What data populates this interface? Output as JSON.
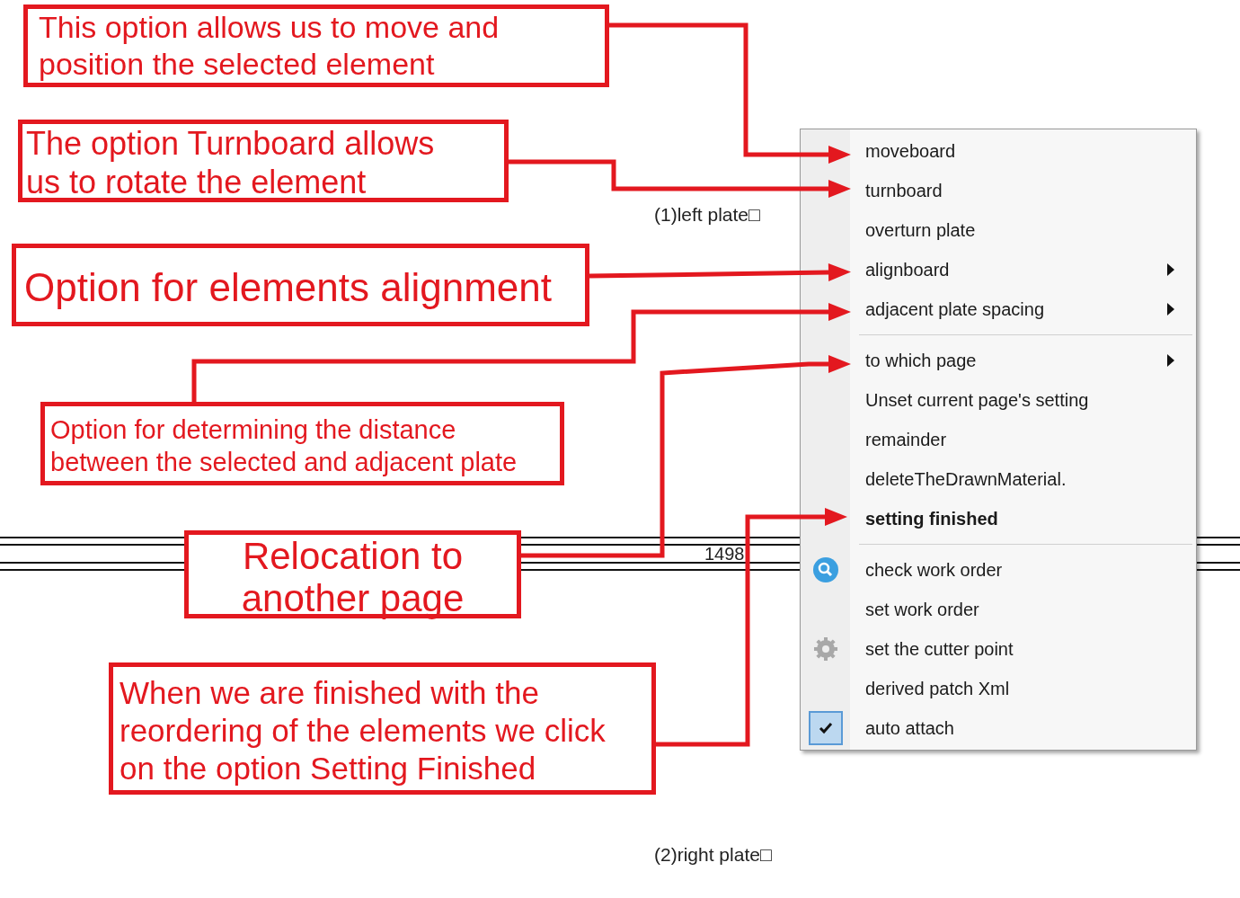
{
  "canvas": {
    "labels": [
      {
        "text": "(1)left plate□"
      },
      {
        "text": "1498"
      },
      {
        "text": "(2)right plate□"
      }
    ]
  },
  "context_menu": {
    "items": [
      {
        "kind": "item",
        "label": "moveboard",
        "submenu": false,
        "default": false,
        "checked": false
      },
      {
        "kind": "item",
        "label": "turnboard",
        "submenu": false,
        "default": false,
        "checked": false
      },
      {
        "kind": "item",
        "label": "overturn plate",
        "submenu": false,
        "default": false,
        "checked": false
      },
      {
        "kind": "item",
        "label": "alignboard",
        "submenu": true,
        "default": false,
        "checked": false
      },
      {
        "kind": "item",
        "label": "adjacent plate spacing",
        "submenu": true,
        "default": false,
        "checked": false
      },
      {
        "kind": "separator"
      },
      {
        "kind": "item",
        "label": "to which page",
        "submenu": true,
        "default": false,
        "checked": false
      },
      {
        "kind": "item",
        "label": "Unset current page's setting",
        "submenu": false,
        "default": false,
        "checked": false
      },
      {
        "kind": "item",
        "label": "remainder",
        "submenu": false,
        "default": false,
        "checked": false
      },
      {
        "kind": "item",
        "label": "deleteTheDrawnMaterial.",
        "submenu": false,
        "default": false,
        "checked": false
      },
      {
        "kind": "item",
        "label": "setting finished",
        "submenu": false,
        "default": true,
        "checked": false
      },
      {
        "kind": "separator"
      },
      {
        "kind": "item",
        "label": "check work order",
        "submenu": false,
        "default": false,
        "checked": false
      },
      {
        "kind": "item",
        "label": "set work order",
        "submenu": false,
        "default": false,
        "checked": false
      },
      {
        "kind": "item",
        "label": "set the cutter point",
        "submenu": false,
        "default": false,
        "checked": false
      },
      {
        "kind": "item",
        "label": "derived patch Xml",
        "submenu": false,
        "default": false,
        "checked": false
      },
      {
        "kind": "item",
        "label": "auto attach",
        "submenu": false,
        "default": false,
        "checked": true
      }
    ]
  },
  "callouts": [
    {
      "text": "This option allows us to move and position the selected element"
    },
    {
      "text": "The option Turnboard allows us to rotate the element"
    },
    {
      "text": "Option for elements alignment"
    },
    {
      "text": "Option for determining the distance between the selected and adjacent plate"
    },
    {
      "text": "Relocation to another page"
    },
    {
      "text": "When we are finished with the reordering of the elements we click on the option Setting Finished"
    }
  ]
}
